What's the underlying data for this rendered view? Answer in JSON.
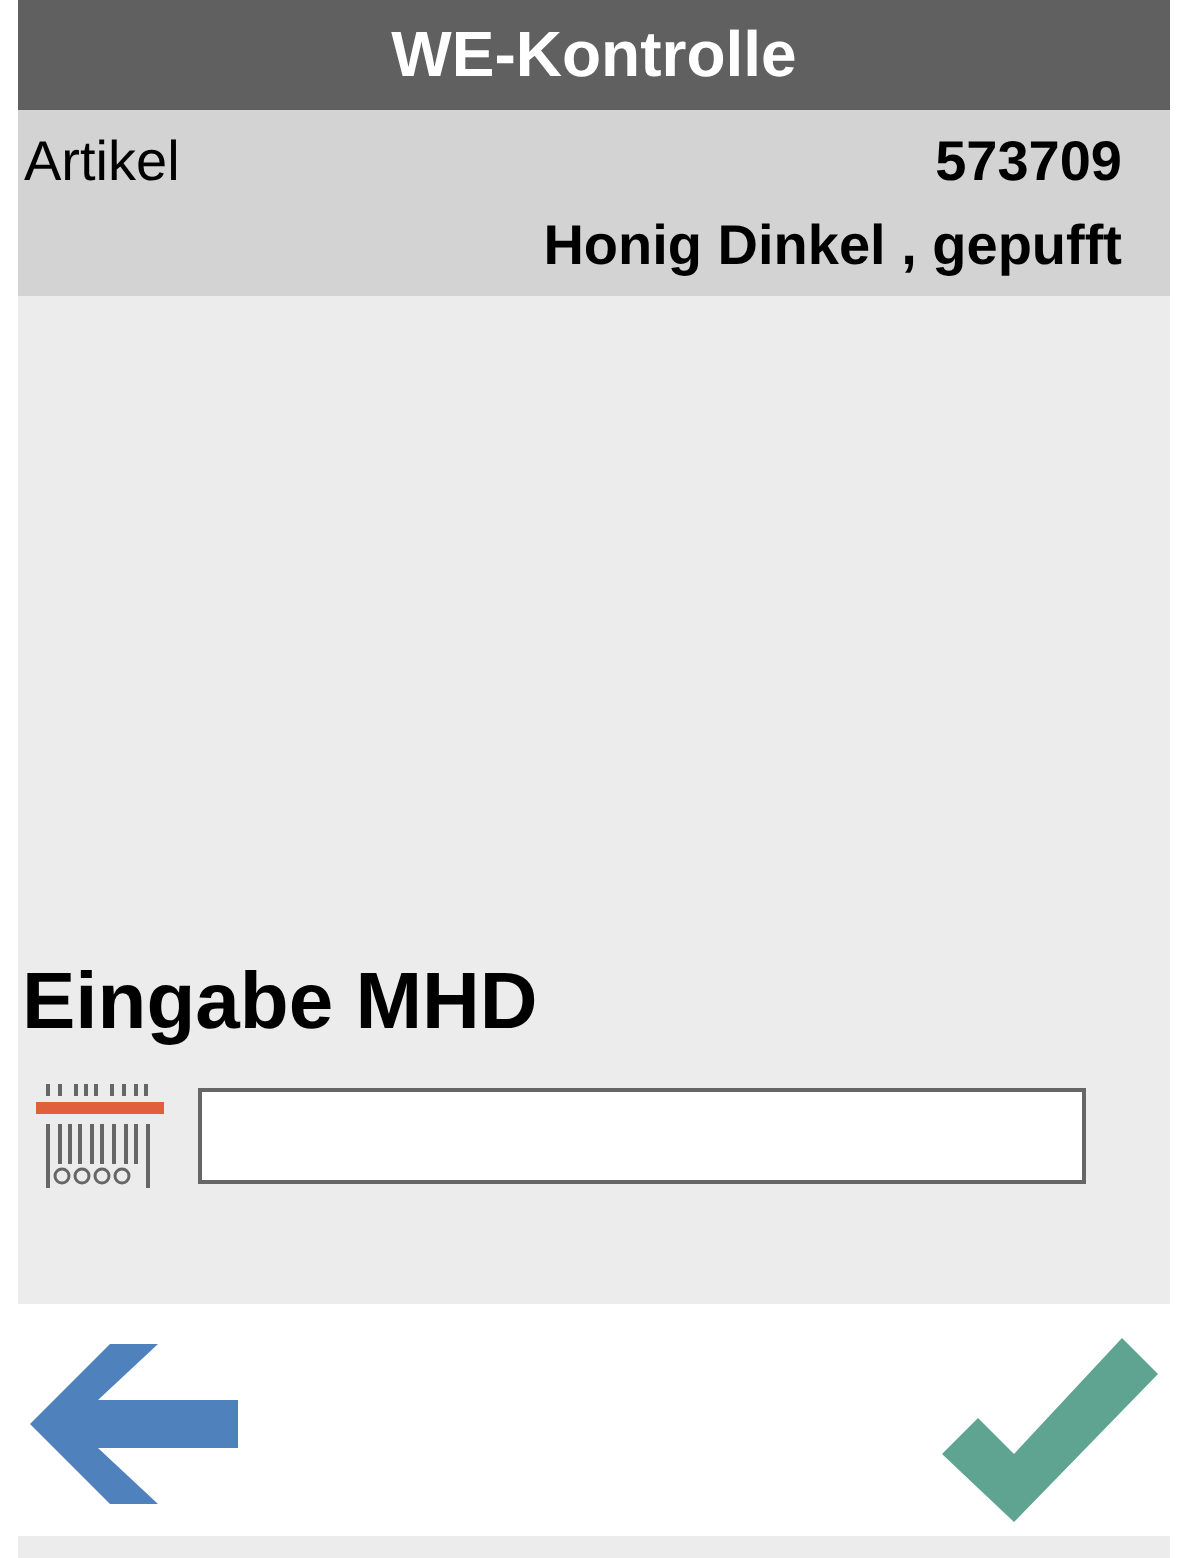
{
  "header": {
    "title": "WE-Kontrolle"
  },
  "article": {
    "label": "Artikel",
    "number": "573709",
    "name": "Honig Dinkel , gepufft"
  },
  "entry": {
    "label": "Eingabe MHD"
  }
}
